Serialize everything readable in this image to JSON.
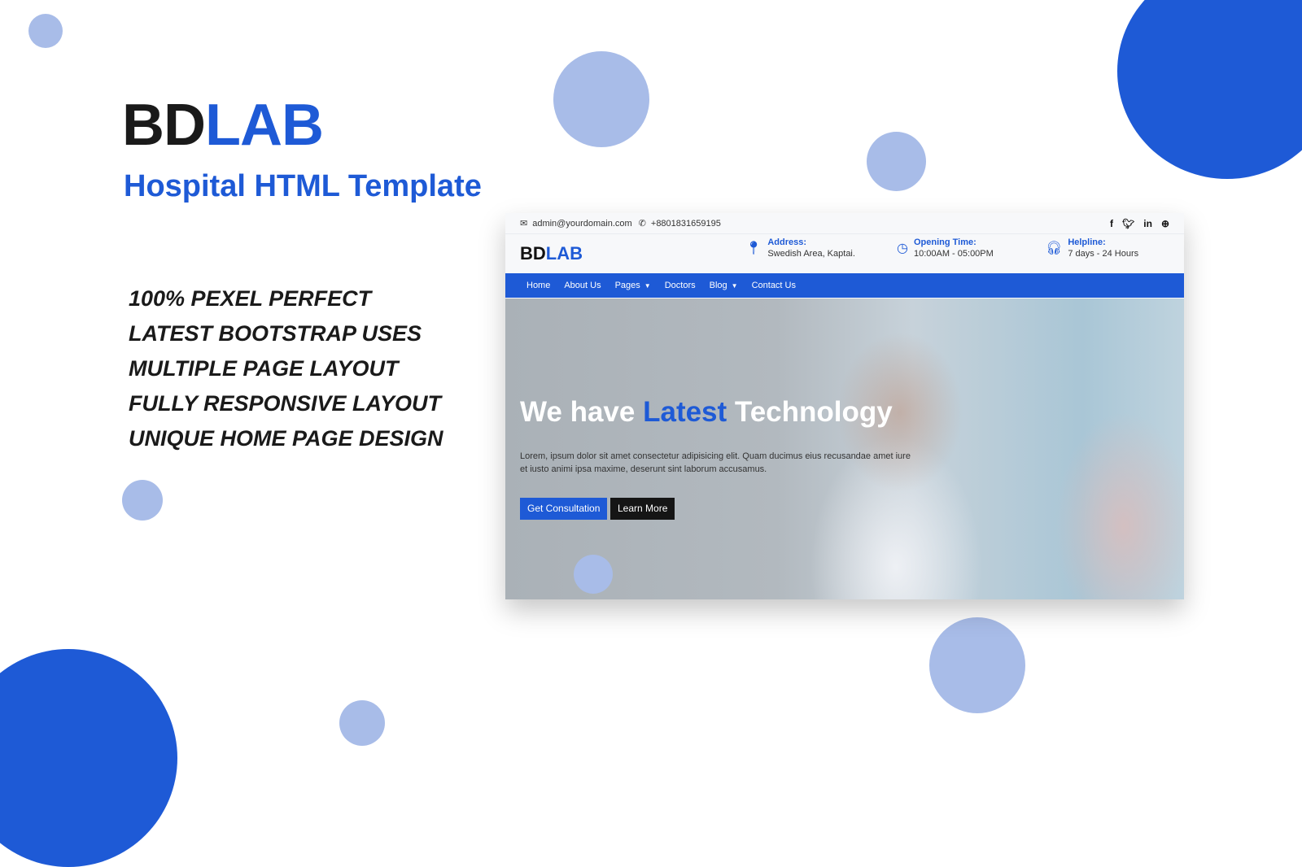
{
  "promo": {
    "brand_part1": "BD",
    "brand_part2": "LAB",
    "subtitle": "Hospital HTML Template",
    "features": [
      "100% PEXEL PERFECT",
      "LATEST BOOTSTRAP USES",
      "MULTIPLE PAGE LAYOUT",
      "FULLY RESPONSIVE LAYOUT",
      "UNIQUE HOME PAGE DESIGN"
    ]
  },
  "colors": {
    "accent": "#1e5ad6",
    "accent_light": "#a8bce8",
    "dark": "#151515"
  },
  "mockup": {
    "topbar": {
      "email": "admin@yourdomain.com",
      "phone": "+8801831659195",
      "socials": [
        "facebook-icon",
        "twitter-icon",
        "linkedin-icon",
        "dribbble-icon"
      ]
    },
    "header": {
      "logo_part1": "BD",
      "logo_part2": "LAB",
      "address_label": "Address:",
      "address_value": "Swedish Area, Kaptai.",
      "opening_label": "Opening Time:",
      "opening_value": "10:00AM - 05:00PM",
      "helpline_label": "Helpline:",
      "helpline_value": "7 days - 24 Hours"
    },
    "nav": [
      {
        "label": "Home",
        "dropdown": false
      },
      {
        "label": "About Us",
        "dropdown": false
      },
      {
        "label": "Pages",
        "dropdown": true
      },
      {
        "label": "Doctors",
        "dropdown": false
      },
      {
        "label": "Blog",
        "dropdown": true
      },
      {
        "label": "Contact Us",
        "dropdown": false
      }
    ],
    "hero": {
      "title_part1": "We have ",
      "title_highlight": "Latest",
      "title_part2": " Technology",
      "text": "Lorem, ipsum dolor sit amet consectetur adipisicing elit. Quam ducimus eius recusandae amet iure et iusto animi ipsa maxime, deserunt sint laborum accusamus.",
      "primary_button": "Get Consultation",
      "secondary_button": "Learn More"
    }
  }
}
